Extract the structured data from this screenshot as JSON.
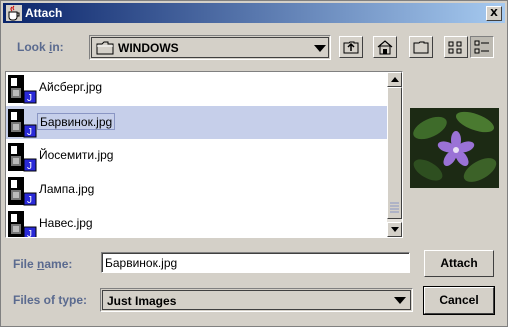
{
  "window": {
    "title": "Attach",
    "close_label": "X"
  },
  "lookin": {
    "label_pre": "Look ",
    "label_u": "i",
    "label_post": "n:",
    "value": "WINDOWS"
  },
  "toolbar": {
    "up_icon": "up-folder-icon",
    "home_icon": "home-icon",
    "newfolder_icon": "new-folder-icon",
    "list_icon": "list-view-icon",
    "details_icon": "details-view-icon"
  },
  "files": [
    {
      "name": "Айсберг.jpg",
      "selected": false
    },
    {
      "name": "Барвинок.jpg",
      "selected": true
    },
    {
      "name": "Йосемити.jpg",
      "selected": false
    },
    {
      "name": "Лампа.jpg",
      "selected": false
    },
    {
      "name": "Навес.jpg",
      "selected": false
    }
  ],
  "filename": {
    "label_pre": "File ",
    "label_u": "n",
    "label_post": "ame:",
    "value": "Барвинок.jpg"
  },
  "filetype": {
    "label": "Files of type:",
    "value": "Just Images"
  },
  "buttons": {
    "attach": "Attach",
    "cancel": "Cancel"
  },
  "colors": {
    "title_start": "#0a246a",
    "title_end": "#a6caf0",
    "selection": "#c6cfea",
    "label": "#5a6a8f"
  }
}
